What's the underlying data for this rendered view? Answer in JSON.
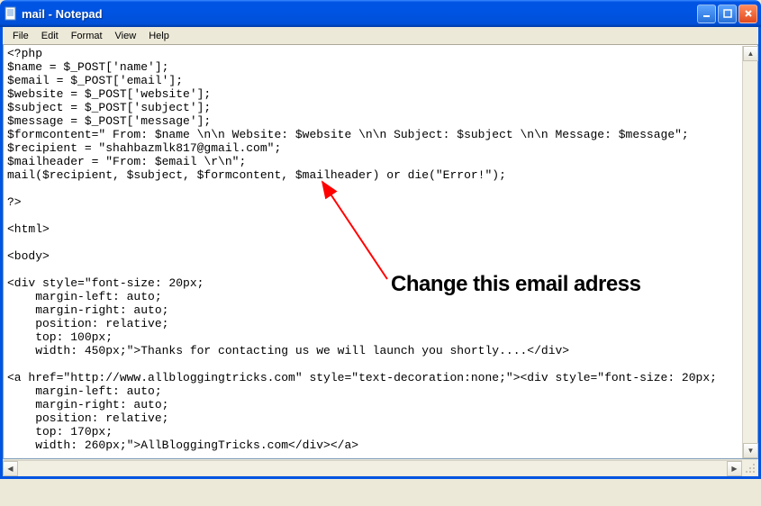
{
  "titlebar": {
    "title": "mail - Notepad"
  },
  "menubar": {
    "file": "File",
    "edit": "Edit",
    "format": "Format",
    "view": "View",
    "help": "Help"
  },
  "editor": {
    "content": "<?php\n$name = $_POST['name'];\n$email = $_POST['email'];\n$website = $_POST['website'];\n$subject = $_POST['subject'];\n$message = $_POST['message'];\n$formcontent=\" From: $name \\n\\n Website: $website \\n\\n Subject: $subject \\n\\n Message: $message\";\n$recipient = \"shahbazmlk817@gmail.com\";\n$mailheader = \"From: $email \\r\\n\";\nmail($recipient, $subject, $formcontent, $mailheader) or die(\"Error!\");\n\n?>\n\n<html>\n\n<body>\n\n<div style=\"font-size: 20px;\n    margin-left: auto;\n    margin-right: auto;\n    position: relative;\n    top: 100px;\n    width: 450px;\">Thanks for contacting us we will launch you shortly....</div>\n\n<a href=\"http://www.allbloggingtricks.com\" style=\"text-decoration:none;\"><div style=\"font-size: 20px;\n    margin-left: auto;\n    margin-right: auto;\n    position: relative;\n    top: 170px;\n    width: 260px;\">AllBloggingTricks.com</div></a>\n\n<html>\n\n<body>"
  },
  "annotation": {
    "text": "Change this email adress"
  }
}
